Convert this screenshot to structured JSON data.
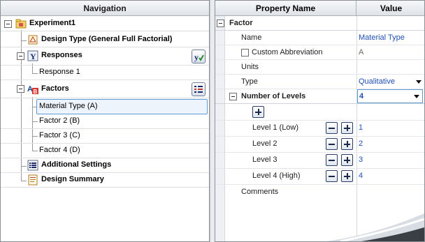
{
  "navigation": {
    "header": "Navigation",
    "experiment": "Experiment1",
    "design_type": "Design Type (General Full Factorial)",
    "responses": "Responses",
    "response_1": "Response 1",
    "factors": "Factors",
    "factor_items": [
      "Material Type (A)",
      "Factor 2 (B)",
      "Factor 3 (C)",
      "Factor 4 (D)"
    ],
    "additional_settings": "Additional Settings",
    "design_summary": "Design Summary"
  },
  "properties": {
    "header_name": "Property Name",
    "header_value": "Value",
    "category": "Factor",
    "name_label": "Name",
    "name_value": "Material Type",
    "custom_abbrev_label": "Custom Abbreviation",
    "custom_abbrev_value": "A",
    "units_label": "Units",
    "type_label": "Type",
    "type_value": "Qualitative",
    "levels_label": "Number of Levels",
    "levels_value": "4",
    "levels": [
      {
        "label": "Level 1 (Low)",
        "value": "1"
      },
      {
        "label": "Level 2",
        "value": "2"
      },
      {
        "label": "Level 3",
        "value": "3"
      },
      {
        "label": "Level 4 (High)",
        "value": "4"
      }
    ],
    "comments_label": "Comments"
  },
  "icons": {
    "experiment": "experiment-folder-icon",
    "design_type": "design-type-icon",
    "responses": "responses-y-icon",
    "factors": "factors-ab-icon",
    "additional_settings": "settings-list-icon",
    "design_summary": "summary-sheet-icon"
  },
  "colors": {
    "value_text": "#1f4fb5",
    "selection_border": "#5a9bd5",
    "header_bg": "#dfe3e8"
  }
}
